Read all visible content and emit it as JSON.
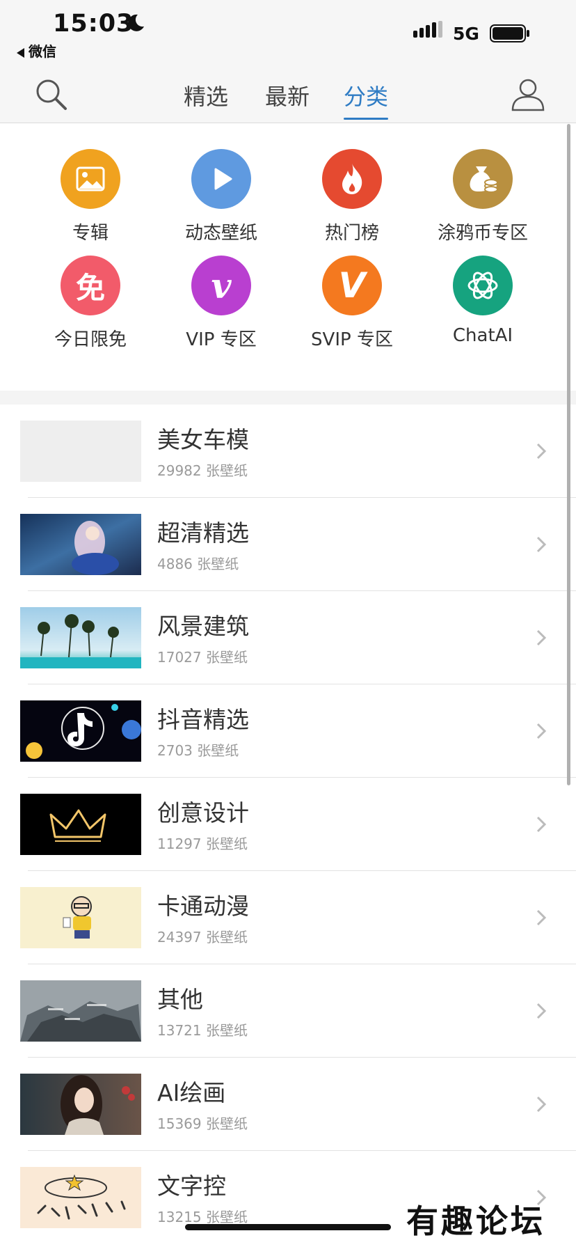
{
  "status": {
    "time": "15:03",
    "back_app": "微信",
    "network": "5G"
  },
  "nav": {
    "tabs": [
      {
        "label": "精选"
      },
      {
        "label": "最新"
      },
      {
        "label": "分类"
      }
    ],
    "active": "分类"
  },
  "categories": [
    {
      "label": "专辑",
      "color": "#f0a21f",
      "icon": "image-icon"
    },
    {
      "label": "动态壁纸",
      "color": "#5f9ae0",
      "icon": "play-icon"
    },
    {
      "label": "热门榜",
      "color": "#e54a30",
      "icon": "flame-icon"
    },
    {
      "label": "涂鸦币专区",
      "color": "#b99040",
      "icon": "money-bag-icon"
    },
    {
      "label": "今日限免",
      "color": "#f25b6a",
      "icon": "free-badge-icon",
      "glyph": "免"
    },
    {
      "label": "VIP 专区",
      "color": "#b93fd0",
      "icon": "vip-v-icon",
      "glyph": "v"
    },
    {
      "label": "SVIP 专区",
      "color": "#f4791f",
      "icon": "svip-v-icon",
      "glyph": "V"
    },
    {
      "label": "ChatAI",
      "color": "#16a37f",
      "icon": "chatai-logo-icon"
    }
  ],
  "list": [
    {
      "title": "美女车模",
      "count": "29982 张壁纸"
    },
    {
      "title": "超清精选",
      "count": "4886 张壁纸"
    },
    {
      "title": "风景建筑",
      "count": "17027 张壁纸"
    },
    {
      "title": "抖音精选",
      "count": "2703 张壁纸"
    },
    {
      "title": "创意设计",
      "count": "11297 张壁纸"
    },
    {
      "title": "卡通动漫",
      "count": "24397 张壁纸"
    },
    {
      "title": "其他",
      "count": "13721 张壁纸"
    },
    {
      "title": "AI绘画",
      "count": "15369 张壁纸"
    },
    {
      "title": "文字控",
      "count": "13215 张壁纸"
    }
  ],
  "watermark": "有趣论坛"
}
